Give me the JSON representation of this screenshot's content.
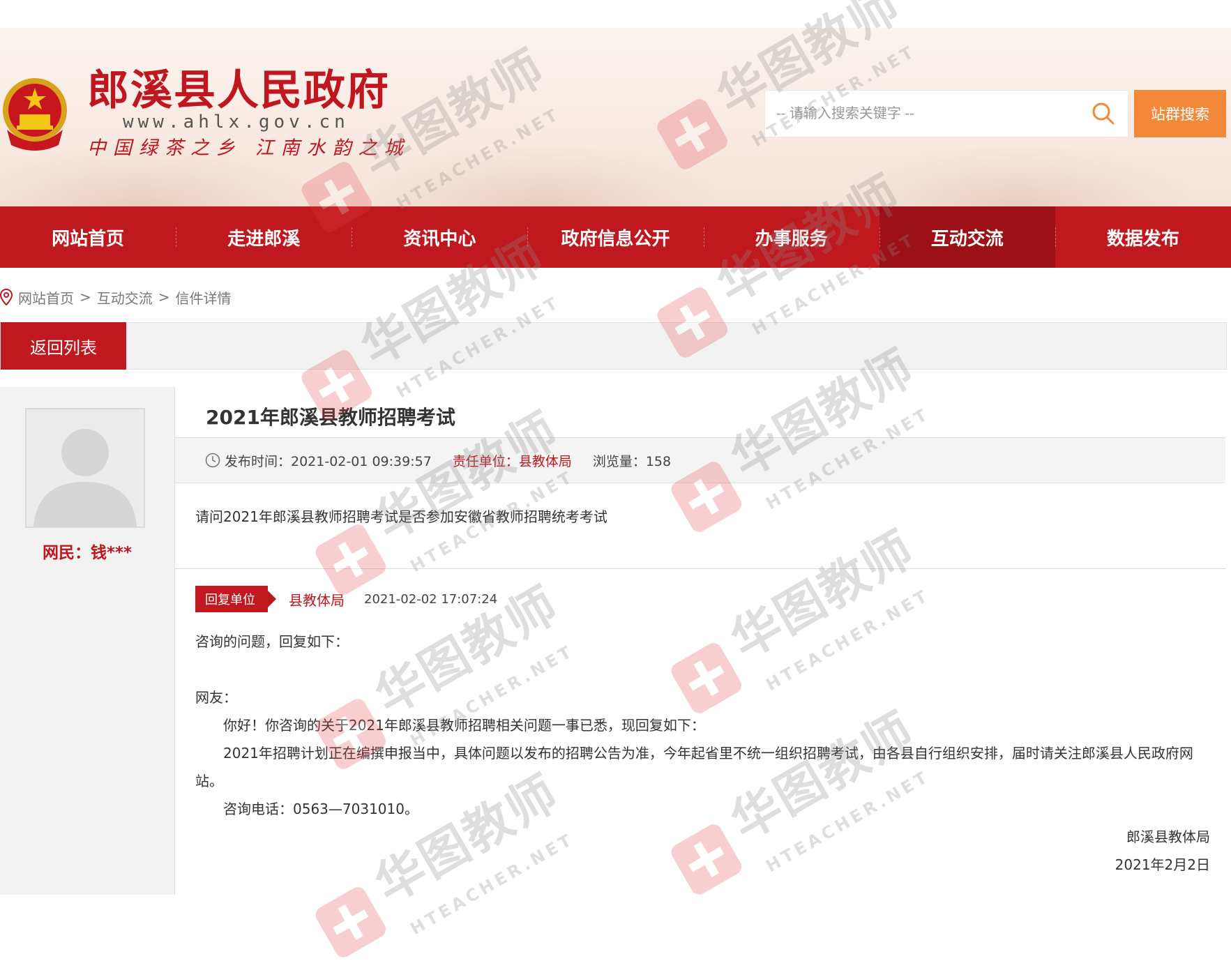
{
  "header": {
    "site_title": "郎溪县人民政府",
    "site_url": "www.ahlx.gov.cn",
    "slogan": "中国绿茶之乡  江南水韵之城",
    "emblem_icon": "national-emblem-icon",
    "search": {
      "placeholder": "-- 请输入搜索关键字 --",
      "button_label": "站群搜索",
      "button_color": "#f2893a"
    }
  },
  "nav": {
    "items": [
      {
        "label": "网站首页"
      },
      {
        "label": "走进郎溪"
      },
      {
        "label": "资讯中心"
      },
      {
        "label": "政府信息公开"
      },
      {
        "label": "办事服务"
      },
      {
        "label": "互动交流",
        "active": true
      },
      {
        "label": "数据发布"
      }
    ],
    "bg_color": "#c0181f",
    "active_color": "#9c1117"
  },
  "breadcrumb": {
    "items": [
      "网站首页",
      "互动交流",
      "信件详情"
    ],
    "separator": ">"
  },
  "back_button_label": "返回列表",
  "user": {
    "name": "网民：钱***"
  },
  "letter": {
    "title": "2021年郎溪县教师招聘考试",
    "publish_label": "发布时间：2021-02-01 09:39:57",
    "dept_label": "责任单位：县教体局",
    "views_label": "浏览量：158",
    "question": "请问2021年郎溪县教师招聘考试是否参加安徽省教师招聘统考考试"
  },
  "reply": {
    "tag": "回复单位",
    "dept": "县教体局",
    "time": "2021-02-02 17:07:24",
    "intro": "咨询的问题，回复如下：",
    "greeting": "网友：",
    "para1": "你好！你咨询的关于2021年郎溪县教师招聘相关问题一事已悉，现回复如下：",
    "para2": "2021年招聘计划正在编撰申报当中，具体问题以发布的招聘公告为准，今年起省里不统一组织招聘考试，由各县自行组织安排，届时请关注郎溪县人民政府网站。",
    "para3": "咨询电话：0563—7031010。",
    "sign_org": "郎溪县教体局",
    "sign_date": "2021年2月2日"
  },
  "watermark": {
    "text": "华图教师",
    "sub_text": "HTEACHER.NET"
  },
  "colors": {
    "brand_red": "#c0161f",
    "search_orange": "#f2893a"
  }
}
